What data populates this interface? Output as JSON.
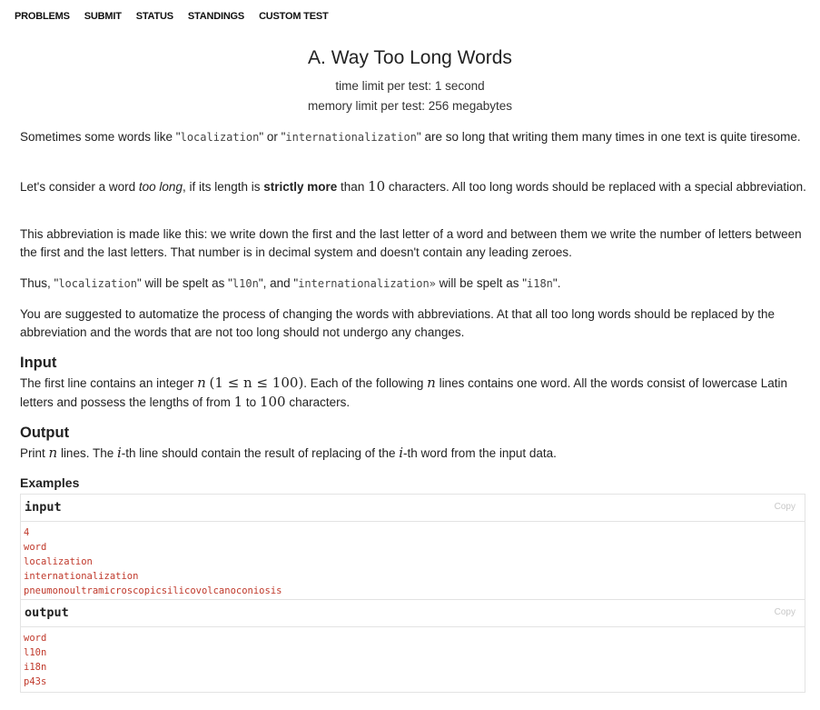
{
  "nav": {
    "problems": "PROBLEMS",
    "submit": "SUBMIT",
    "status": "STATUS",
    "standings": "STANDINGS",
    "custom_test": "CUSTOM TEST"
  },
  "problem": {
    "title": "A. Way Too Long Words",
    "time_limit": "time limit per test: 1 second",
    "memory_limit": "memory limit per test: 256 megabytes"
  },
  "statement": {
    "p1": {
      "a": "Sometimes some words like \"",
      "code1": "localization",
      "b": "\" or \"",
      "code2": "internationalization",
      "c": "\" are so long that writing them many times in one text is quite tiresome."
    },
    "p2": {
      "a": "Let's consider a word ",
      "em": "too long",
      "b": ", if its length is ",
      "strong": "strictly more",
      "c": " than ",
      "num": "10",
      "d": " characters. All too long words should be replaced with a special abbreviation."
    },
    "p3": "This abbreviation is made like this: we write down the first and the last letter of a word and between them we write the number of letters between the first and the last letters. That number is in decimal system and doesn't contain any leading zeroes.",
    "p4": {
      "a": "Thus, \"",
      "code1": "localization",
      "b": "\" will be spelt as \"",
      "code2": "l10n",
      "c": "\", and \"",
      "code3": "internationalization»",
      "d": " will be spelt as \"",
      "code4": "i18n",
      "e": "\"."
    },
    "p5": "You are suggested to automatize the process of changing the words with abbreviations. At that all too long words should be replaced by the abbreviation and the words that are not too long should not undergo any changes."
  },
  "input_section": {
    "title": "Input",
    "a": "The first line contains an integer ",
    "n1": "n",
    "range": "(1 ≤ n ≤ 100)",
    "b": ". Each of the following ",
    "n2": "n",
    "c": " lines contains one word. All the words consist of lowercase Latin letters and possess the lengths of from ",
    "from": "1",
    "d": " to ",
    "to": "100",
    "e": " characters."
  },
  "output_section": {
    "title": "Output",
    "a": "Print ",
    "n": "n",
    "b": " lines. The ",
    "i1": "i",
    "c": "-th line should contain the result of replacing of the ",
    "i2": "i",
    "d": "-th word from the input data."
  },
  "examples": {
    "title": "Examples",
    "input_label": "input",
    "output_label": "output",
    "copy_label": "Copy",
    "input_lines": [
      "4",
      "word",
      "localization",
      "internationalization",
      "pneumonoultramicroscopicsilicovolcanoconiosis"
    ],
    "output_lines": [
      "word",
      "l10n",
      "i18n",
      "p43s"
    ]
  }
}
